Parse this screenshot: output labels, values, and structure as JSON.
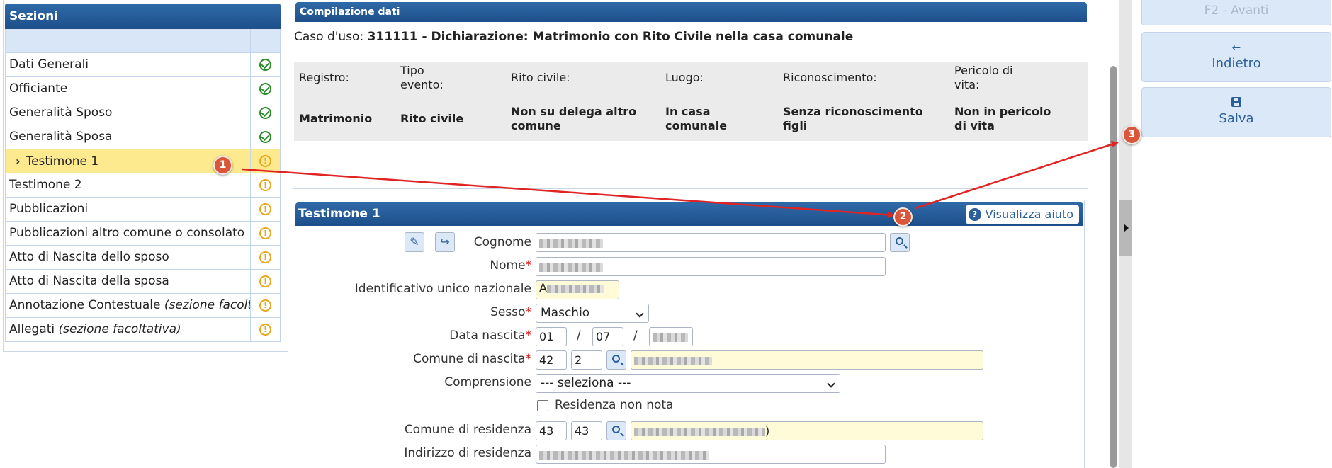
{
  "sidebar": {
    "title": "Sezioni",
    "items": [
      {
        "label": "Dati Generali",
        "status": "ok"
      },
      {
        "label": "Officiante",
        "status": "ok"
      },
      {
        "label": "Generalità Sposo",
        "status": "ok"
      },
      {
        "label": "Generalità Sposa",
        "status": "ok"
      },
      {
        "label": "Testimone 1",
        "status": "warn",
        "selected": true
      },
      {
        "label": "Testimone 2",
        "status": "warn"
      },
      {
        "label": "Pubblicazioni",
        "status": "warn"
      },
      {
        "label": "Pubblicazioni altro comune o consolato",
        "status": "warn"
      },
      {
        "label": "Atto di Nascita dello sposo",
        "status": "warn"
      },
      {
        "label": "Atto di Nascita della sposa",
        "status": "warn"
      },
      {
        "label": "Annotazione Contestuale",
        "note": "(sezione facoltativa)",
        "status": "warn"
      },
      {
        "label": "Allegati",
        "note": "(sezione facoltativa)",
        "status": "warn"
      }
    ],
    "warn_glyph": "!"
  },
  "data_panel": {
    "title": "Compilazione dati",
    "usecase_label": "Caso d'uso:",
    "usecase_value": "311111 - Dichiarazione: Matrimonio con Rito Civile nella casa comunale",
    "summary": {
      "registro_h": "Registro:",
      "registro_v": "Matrimonio",
      "tipo_h": "Tipo evento:",
      "tipo_v": "Rito civile",
      "rito_h": "Rito civile:",
      "rito_v": "Non su delega altro comune",
      "luogo_h": "Luogo:",
      "luogo_v": "In casa comunale",
      "ricon_h": "Riconoscimento:",
      "ricon_v": "Senza riconoscimento figli",
      "peric_h": "Pericolo di vita:",
      "peric_v": "Non in pericolo di vita"
    }
  },
  "witness": {
    "title": "Testimone 1",
    "help_label": "Visualizza aiuto",
    "cognome_label": "Cognome",
    "nome_label": "Nome",
    "id_label": "Identificativo unico nazionale",
    "id_prefix": "A",
    "sesso_label": "Sesso",
    "sesso_value": "Maschio",
    "data_label": "Data nascita",
    "dn_day": "01",
    "dn_month": "07",
    "date_sep": "/",
    "comune_nascita_label": "Comune di nascita",
    "cn_code1": "42",
    "cn_code2": "2",
    "compr_label": "Comprensione",
    "compr_value": "--- seleziona ---",
    "res_non_nota_label": "Residenza non nota",
    "comune_res_label": "Comune di residenza",
    "cr_code1": "43",
    "cr_code2": "43",
    "cr_suffix": ")",
    "indirizzo_label": "Indirizzo di residenza",
    "required_mark": "*"
  },
  "actions": {
    "avanti": "F2 - Avanti",
    "indietro_icon": "←",
    "indietro": "Indietro",
    "salva": "Salva"
  },
  "annotations": [
    "1",
    "2",
    "3"
  ],
  "colors": {
    "header_blue": "#1d4f8a",
    "ok_green": "#2a8c2a",
    "warn_orange": "#e8a81c",
    "annotation_red": "#e02424",
    "selected_row": "#fde98e"
  }
}
